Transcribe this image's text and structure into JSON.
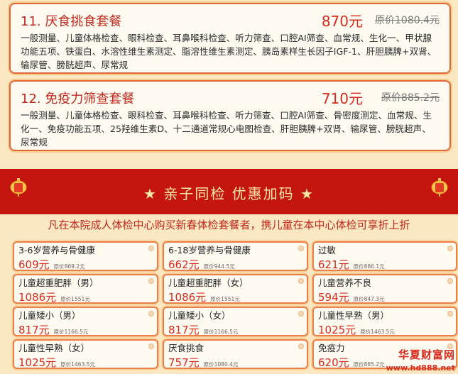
{
  "packages": [
    {
      "title": "11. 厌食挑食套餐",
      "price": "870元",
      "original": "原价1080.4元",
      "desc": "一般测量、儿童体格检查、眼科检查、耳鼻喉科检查、听力筛查、口腔AI筛查、血常规、生化一、甲状腺功能五项、铁蛋白、水溶性维生素测定、脂溶性维生素测定、胰岛素样生长因子IGF-1、肝胆胰脾+双肾、输尿管、膀胱超声、尿常规"
    },
    {
      "title": "12. 免疫力筛查套餐",
      "price": "710元",
      "original": "原价885.2元",
      "desc": "一般测量、儿童体格检查、眼科检查、耳鼻喉科检查、听力筛查、口腔AI筛查、骨密度测定、血常规、生化一、免疫功能五项、25羟维生素D、十二通道常规心电图检查、肝胆胰脾+双肾、输尿管、膀胱超声、尿常规"
    }
  ],
  "banner": {
    "title": "★ 亲子同检 优惠加码 ★"
  },
  "promo": "凡在本院成人体检中心购买新春体检套餐者，携儿童在本中心体检可享折上折",
  "items": [
    {
      "name": "3-6岁营养与骨健康",
      "price": "609元",
      "original": "原价869.2元"
    },
    {
      "name": "6-18岁营养与骨健康",
      "price": "662元",
      "original": "原价944.5元"
    },
    {
      "name": "过敏",
      "price": "621元",
      "original": "原价886.1元"
    },
    {
      "name": "儿童超重肥胖（男）",
      "price": "1086元",
      "original": "原价1551元"
    },
    {
      "name": "儿童超重肥胖（女）",
      "price": "1086元",
      "original": "原价1551元"
    },
    {
      "name": "儿童营养不良",
      "price": "594元",
      "original": "原价847.3元"
    },
    {
      "name": "儿童矮小（男）",
      "price": "817元",
      "original": "原价1166.5元"
    },
    {
      "name": "儿童矮小（女）",
      "price": "817元",
      "original": "原价1166.5元"
    },
    {
      "name": "儿童性早熟（男）",
      "price": "1025元",
      "original": "原价1463.5元"
    },
    {
      "name": "儿童性早熟（女）",
      "price": "1025元",
      "original": "原价1463.5元"
    },
    {
      "name": "厌食挑食",
      "price": "757元",
      "original": "原价1080.4元"
    },
    {
      "name": "免疫力",
      "price": "620元",
      "original": "原价885.2元"
    }
  ],
  "watermark": {
    "title": "华夏财富网",
    "url": "www.hd888.net"
  },
  "colors": {
    "accent": "#c4150e",
    "price": "#d62b1e",
    "background": "#fbe7c2"
  },
  "icons": [
    "lantern-icon",
    "lantern-icon"
  ]
}
